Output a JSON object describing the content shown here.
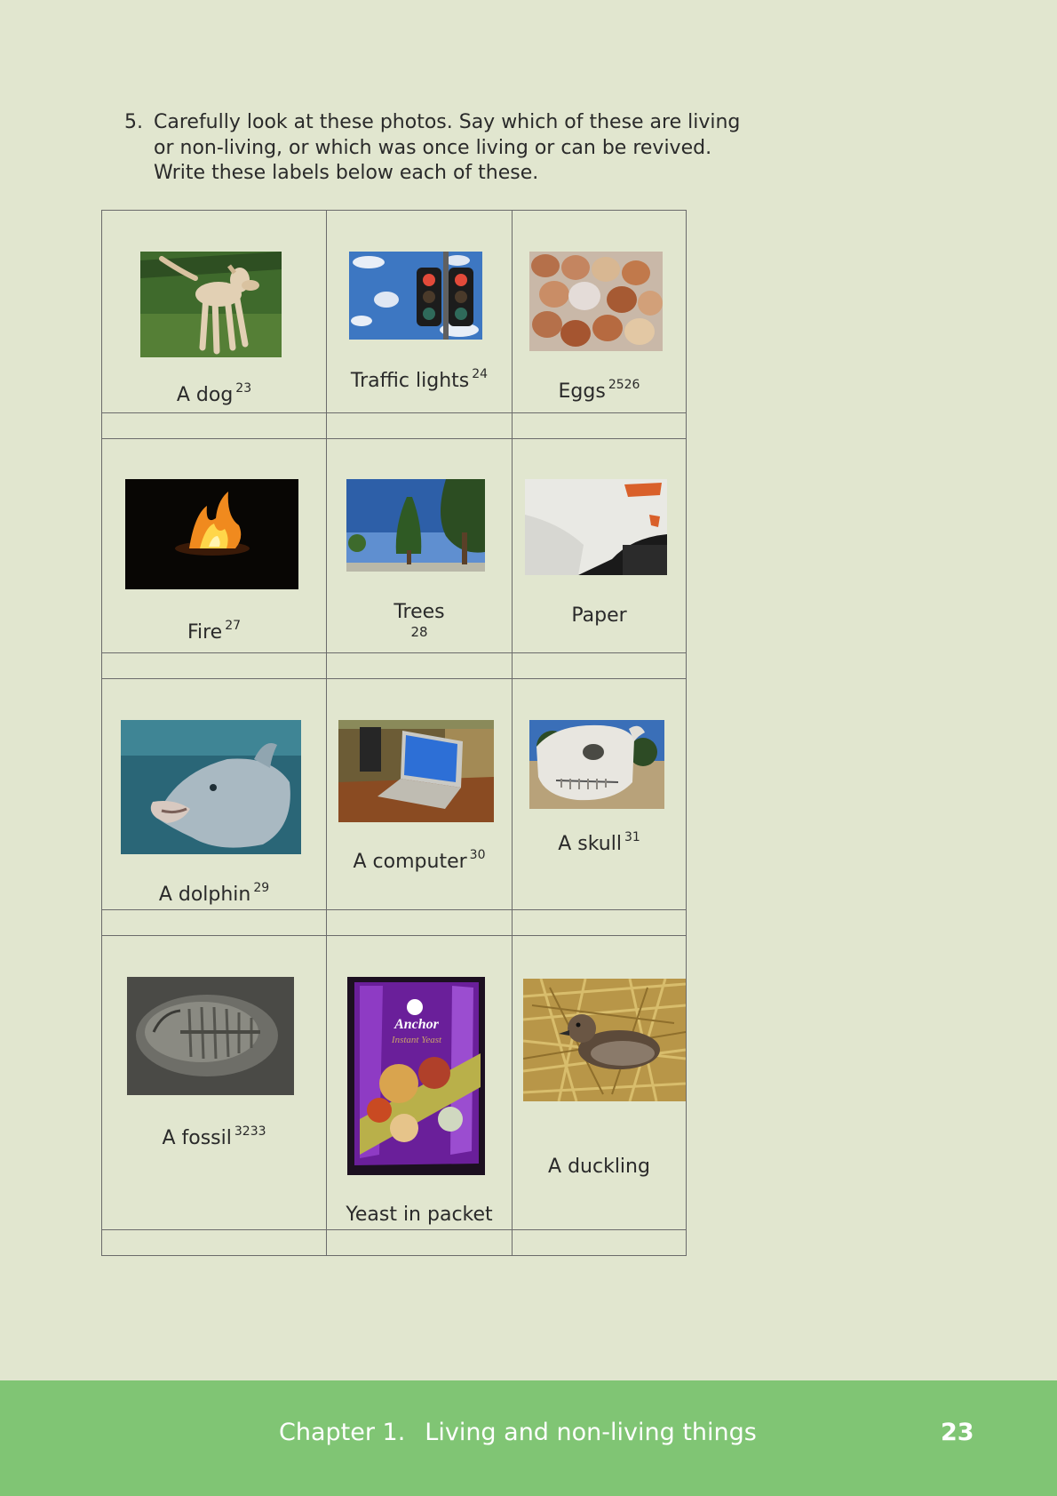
{
  "question": {
    "number": "5.",
    "lines": [
      "Carefully look at these photos. Say which of these are living",
      "or non-living, or which was once living or can be revived.",
      "Write these labels below each of these."
    ]
  },
  "items": [
    {
      "caption": "A dog",
      "ref": "23",
      "photo": "dog-photo"
    },
    {
      "caption": "Traffic lights",
      "ref": "24",
      "photo": "traffic-lights-photo"
    },
    {
      "caption": "Eggs",
      "ref": "2526",
      "photo": "eggs-photo"
    },
    {
      "caption": "Fire",
      "ref": "27",
      "photo": "fire-photo"
    },
    {
      "caption": "Trees",
      "ref": "28",
      "photo": "trees-photo"
    },
    {
      "caption": "Paper",
      "ref": "",
      "photo": "paper-photo"
    },
    {
      "caption": "A dolphin",
      "ref": "29",
      "photo": "dolphin-photo"
    },
    {
      "caption": "A computer",
      "ref": "30",
      "photo": "computer-photo"
    },
    {
      "caption": "A skull",
      "ref": "31",
      "photo": "skull-photo"
    },
    {
      "caption": "A fossil",
      "ref": "3233",
      "photo": "fossil-photo"
    },
    {
      "caption": "Yeast in packet",
      "ref": "",
      "photo": "yeast-packet-photo",
      "packet_brand": "Anchor",
      "packet_sub": "Instant Yeast"
    },
    {
      "caption": "A duckling",
      "ref": "",
      "photo": "duckling-photo"
    }
  ],
  "footer": {
    "chapter_label": "Chapter 1.",
    "chapter_title": "Living and non-living things",
    "page_number": "23"
  },
  "colors": {
    "page_background": "#e1e6cf",
    "footer_band": "#80c574"
  }
}
